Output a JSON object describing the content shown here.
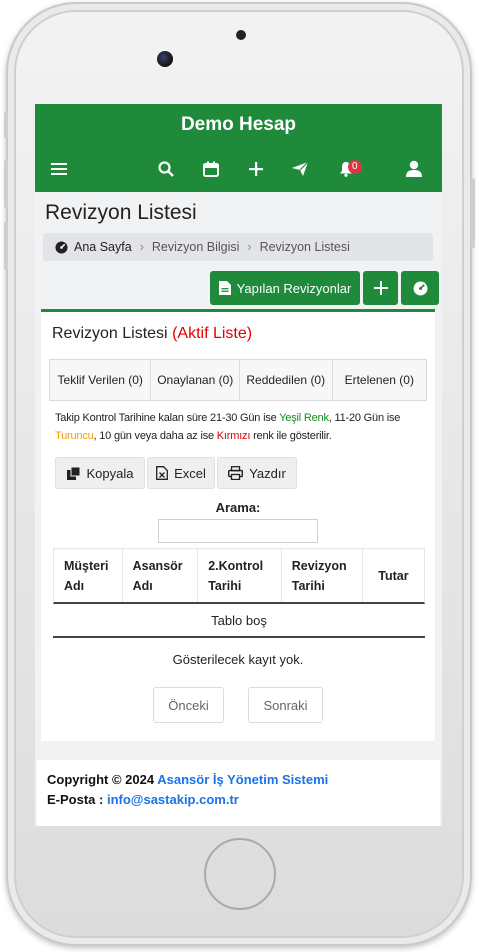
{
  "app": {
    "title": "Demo Hesap"
  },
  "nav": {
    "icons": [
      "menu-icon",
      "search-icon",
      "calendar-icon",
      "plus-icon",
      "send-icon",
      "bell-icon",
      "user-icon"
    ],
    "notification_count": "0"
  },
  "page": {
    "title": "Revizyon Listesi",
    "breadcrumb": [
      "Ana Sayfa",
      "Revizyon Bilgisi",
      "Revizyon Listesi"
    ]
  },
  "actions": {
    "done_revisions": "Yapılan Revizyonlar"
  },
  "card": {
    "title": "Revizyon Listesi",
    "title_status": "(Aktif Liste)",
    "tabs": [
      "Teklif Verilen (0)",
      "Onaylanan (0)",
      "Reddedilen (0)",
      "Ertelenen (0)"
    ],
    "info": {
      "part1": "Takip Kontrol Tarihine kalan süre 21-30 Gün ise ",
      "green": "Yeşil Renk",
      "part2": ", 11-20 Gün ise ",
      "orange": "Turuncu",
      "part3": ", 10 gün veya daha az ise ",
      "red": "Kırmızı",
      "part4": " renk ile gösterilir."
    },
    "tools": {
      "copy": "Kopyala",
      "excel": "Excel",
      "print": "Yazdır"
    },
    "search": {
      "label": "Arama:",
      "value": ""
    },
    "table": {
      "headers": [
        "Müşteri Adı",
        "Asansör Adı",
        "2.Kontrol Tarihi",
        "Revizyon Tarihi",
        "Tutar"
      ],
      "empty": "Tablo boş"
    },
    "no_records": "Gösterilecek kayıt yok.",
    "pager": {
      "prev": "Önceki",
      "next": "Sonraki"
    }
  },
  "footer": {
    "copyright": "Copyright © 2024",
    "system": "Asansör İş Yönetim Sistemi",
    "email_label": "E-Posta :",
    "email": "info@sastakip.com.tr"
  },
  "colors": {
    "primary": "#1f8a3a",
    "danger": "#e00000",
    "warning": "#f59f00",
    "link": "#1a73e8"
  }
}
